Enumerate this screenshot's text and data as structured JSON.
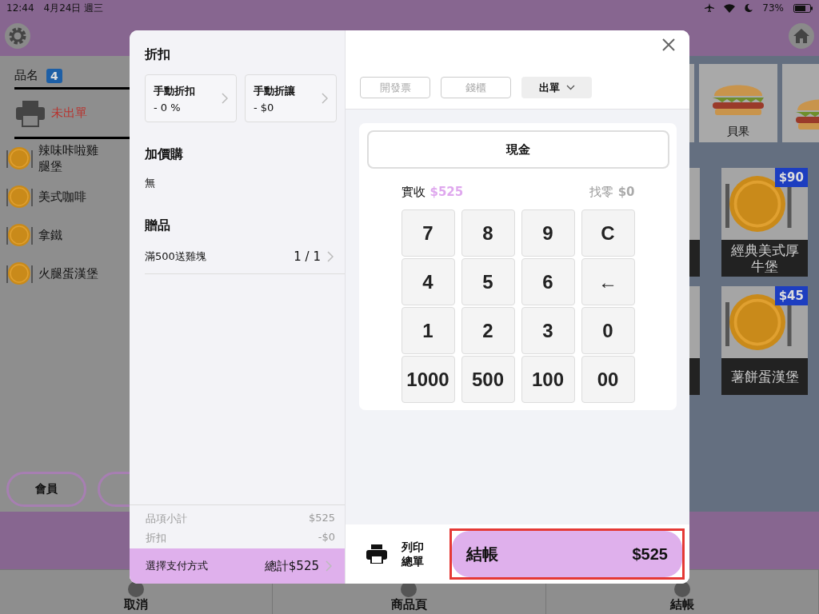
{
  "status_bar": {
    "time": "12:44",
    "date": "4月24日 週三",
    "battery": "73%"
  },
  "order_panel": {
    "header": "品名",
    "count": "4",
    "print_status": "未出單",
    "items": [
      {
        "name": "辣味咔啦雞腿堡"
      },
      {
        "name": "美式咖啡"
      },
      {
        "name": "拿鐵"
      },
      {
        "name": "火腿蛋漢堡"
      }
    ],
    "buttons": [
      "會員"
    ]
  },
  "categories": [
    {
      "label": "貝果"
    }
  ],
  "products": [
    {
      "price": "$90",
      "name": "經典美式厚牛堡"
    },
    {
      "price": "$45",
      "name": "薯餅蛋漢堡"
    }
  ],
  "modal": {
    "discount": {
      "title": "折扣",
      "cards": [
        {
          "label": "手動折扣",
          "value": "- 0 %"
        },
        {
          "label": "手動折讓",
          "value": "- $0"
        }
      ]
    },
    "add_on": {
      "title": "加價購",
      "value": "無"
    },
    "gifts": {
      "title": "贈品",
      "items": [
        {
          "name": "滿500送雞塊",
          "count": "1 / 1"
        }
      ]
    },
    "summary": [
      {
        "label": "品項小計",
        "value": "$525"
      },
      {
        "label": "折扣",
        "value": "-$0"
      }
    ],
    "payment_bar": {
      "label": "選擇支付方式",
      "total": "總計$525"
    },
    "actions": [
      {
        "label": "開發票",
        "kind": "button",
        "disabled": true
      },
      {
        "label": "錢櫃",
        "kind": "button",
        "disabled": true
      },
      {
        "label": "出單",
        "kind": "dropdown",
        "disabled": false
      }
    ],
    "method": "現金",
    "received": {
      "label": "實收",
      "amount": "$525"
    },
    "change": {
      "label": "找零",
      "amount": "$0"
    },
    "keys": [
      "7",
      "8",
      "9",
      "C",
      "4",
      "5",
      "6",
      "←",
      "1",
      "2",
      "3",
      "0",
      "1000",
      "500",
      "100",
      "00"
    ],
    "print_button": "列印總單",
    "checkout": {
      "label": "結帳",
      "amount": "$525",
      "highlighted": true
    }
  },
  "bottom_tabs": [
    {
      "label": "取消"
    },
    {
      "label": "商品頁"
    },
    {
      "label": "結帳"
    }
  ]
}
